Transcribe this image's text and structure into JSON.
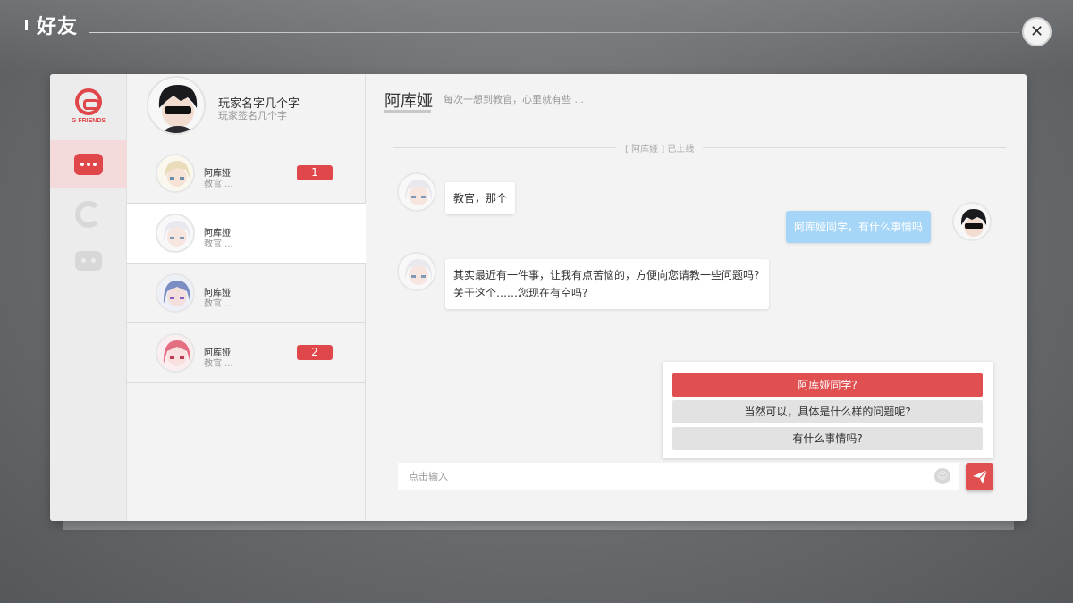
{
  "window": {
    "title": "好友",
    "close_icon": "close-icon"
  },
  "logo": {
    "text": "G FRIENDS",
    "color": "#e0474a"
  },
  "rail": {
    "items": [
      {
        "name": "messages",
        "icon": "chat-bubble-icon",
        "active": true
      },
      {
        "name": "circle",
        "icon": "c-logo-icon",
        "active": false
      },
      {
        "name": "robot",
        "icon": "robot-icon",
        "active": false
      }
    ]
  },
  "profile": {
    "name": "玩家名字几个字",
    "signature": "玩家签名几个字"
  },
  "friends": [
    {
      "name": "阿库娅",
      "preview": "教官 ...",
      "unread": "1",
      "selected": false
    },
    {
      "name": "阿库娅",
      "preview": "教官 ...",
      "unread": "",
      "selected": true
    },
    {
      "name": "阿库娅",
      "preview": "教官 ...",
      "unread": "",
      "selected": false
    },
    {
      "name": "阿库娅",
      "preview": "教官 ...",
      "unread": "2",
      "selected": false
    }
  ],
  "chat": {
    "name": "阿库娅",
    "signature": "每次一想到教官，心里就有些 ...",
    "status": "[ 阿库娅 ] 已上线",
    "messages": [
      {
        "from": "friend",
        "text": "教官，那个"
      },
      {
        "from": "me",
        "text": "阿库娅同学，有什么事情吗"
      },
      {
        "from": "friend",
        "line1": "其实最近有一件事，让我有点苦恼的，方便向您请教一些问题吗?",
        "line2": "关于这个……您现在有空吗?"
      }
    ],
    "choices": [
      {
        "text": "阿库娅同学?",
        "active": true
      },
      {
        "text": "当然可以，具体是什么样的问题呢?",
        "active": false
      },
      {
        "text": "有什么事情吗?",
        "active": false
      }
    ],
    "input": {
      "placeholder": "点击输入",
      "value": ""
    },
    "send_icon": "paper-plane-icon",
    "emoji_icon": "smiley-icon"
  },
  "colors": {
    "accent": "#e0474a",
    "my_bubble": "#a6d6f7",
    "panel_bg": "#f3f3f4"
  }
}
